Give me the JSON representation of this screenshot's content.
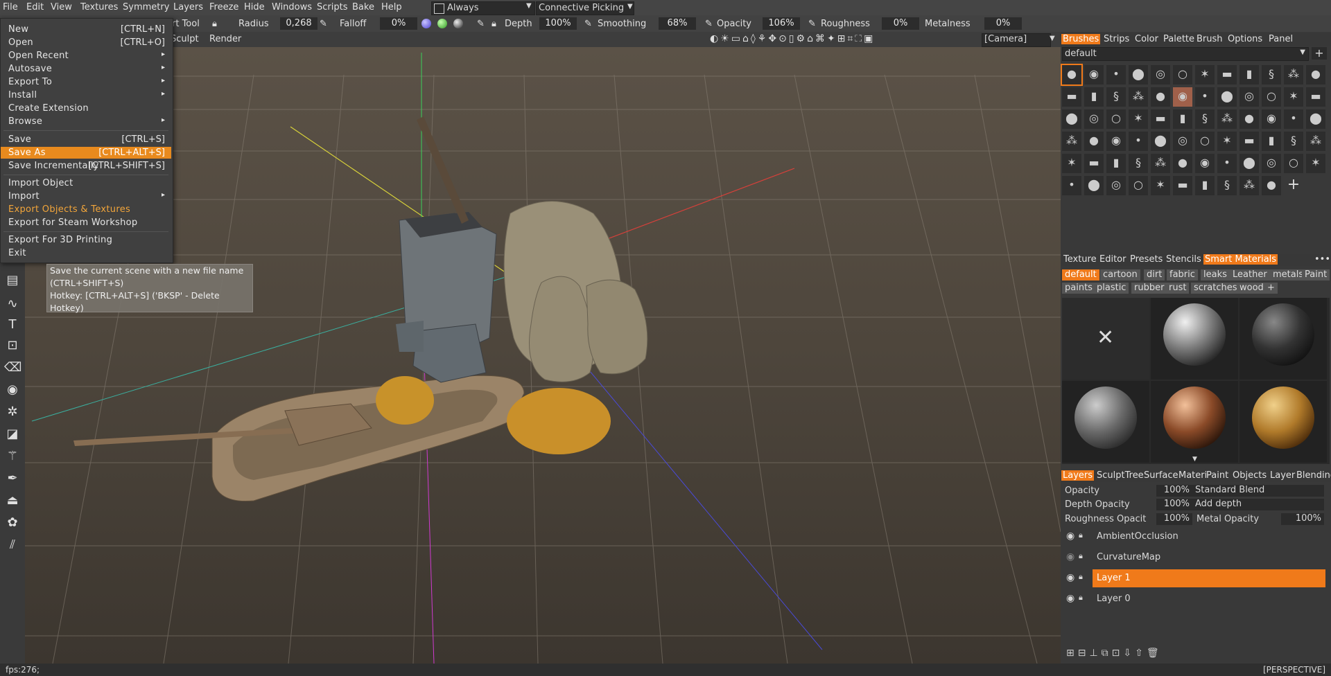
{
  "menubar": {
    "items": [
      "File",
      "Edit",
      "View",
      "Textures",
      "Symmetry",
      "Layers",
      "Freeze",
      "Hide",
      "Windows",
      "Scripts",
      "Bake",
      "Help"
    ],
    "always_label": "Always",
    "picking_label": "Connective Picking"
  },
  "toolbar": {
    "tool_label": "rt Tool",
    "radius_label": "Radius",
    "radius_value": "0,268",
    "falloff_label": "Falloff",
    "falloff_value": "0%",
    "depth_label": "Depth",
    "depth_value": "100%",
    "smoothing_label": "Smoothing",
    "smoothing_value": "68%",
    "opacity_label": "Opacity",
    "opacity_value": "106%",
    "roughness_label": "Roughness",
    "roughness_value": "0%",
    "metalness_label": "Metalness",
    "metalness_value": "0%",
    "sculpt_label": "Sculpt",
    "render_label": "Render",
    "camera_label": "[Camera]"
  },
  "filemenu": {
    "items": [
      {
        "label": "New",
        "key": "[CTRL+N]"
      },
      {
        "label": "Open",
        "key": "[CTRL+O]"
      },
      {
        "label": "Open Recent",
        "key": "▸"
      },
      {
        "label": "Autosave",
        "key": "▸"
      },
      {
        "label": "Export To",
        "key": "▸"
      },
      {
        "label": "Install",
        "key": "▸"
      },
      {
        "label": "Create Extension",
        "key": ""
      },
      {
        "label": "Browse",
        "key": "▸"
      },
      {
        "label": "Save",
        "key": "[CTRL+S]"
      },
      {
        "label": "Save As",
        "key": "[CTRL+ALT+S]"
      },
      {
        "label": "Save Incrementally",
        "key": "[CTRL+SHIFT+S]"
      },
      {
        "label": "Import Object",
        "key": ""
      },
      {
        "label": "Import",
        "key": "▸"
      },
      {
        "label": "Export Objects & Textures",
        "key": ""
      },
      {
        "label": "Export for Steam Workshop",
        "key": ""
      },
      {
        "label": "Export For 3D Printing",
        "key": ""
      },
      {
        "label": "Exit",
        "key": ""
      }
    ],
    "tooltip_line1": "Save the current scene with a new file name",
    "tooltip_line2": "(CTRL+SHIFT+S)",
    "tooltip_line3": "Hotkey: [CTRL+ALT+S]   ('BKSP' - Delete",
    "tooltip_line4": "Hotkey)"
  },
  "brushes_panel": {
    "tabs": [
      "Brushes",
      "Strips",
      "Color",
      "Palette",
      "Brush",
      "Options",
      "Panel"
    ],
    "preset": "default"
  },
  "smart_panel": {
    "tabs": [
      "Texture",
      "Editor",
      "Presets",
      "Stencils",
      "Smart Materials"
    ],
    "chips_row1": [
      "default",
      "cartoon",
      "dirt",
      "fabric",
      "leaks",
      "Leather",
      "metals",
      "Paint"
    ],
    "chips_row2": [
      "paints",
      "plastic",
      "rubber",
      "rust",
      "scratches",
      "wood",
      "+"
    ]
  },
  "layers_panel": {
    "tabs": [
      "Layers",
      "SculptTree",
      "Surface",
      "Materi",
      "Paint",
      "Objects",
      "Layer",
      "Blending"
    ],
    "opacity_label": "Opacity",
    "opacity_value": "100%",
    "blend_mode": "Standard Blend",
    "depth_label": "Depth Opacity",
    "depth_value": "100%",
    "depth_mode": "Add depth",
    "rough_label": "Roughness Opacit",
    "rough_value": "100%",
    "metal_label": "Metal Opacity",
    "metal_value": "100%",
    "layers": [
      "AmbientOcclusion",
      "CurvatureMap",
      "Layer 1",
      "Layer 0"
    ]
  },
  "status": {
    "fps": "fps:276;",
    "view": "[PERSPECTIVE]"
  },
  "colors": {
    "accent": "#f07a1a",
    "menu_highlight": "#e88a1e"
  }
}
